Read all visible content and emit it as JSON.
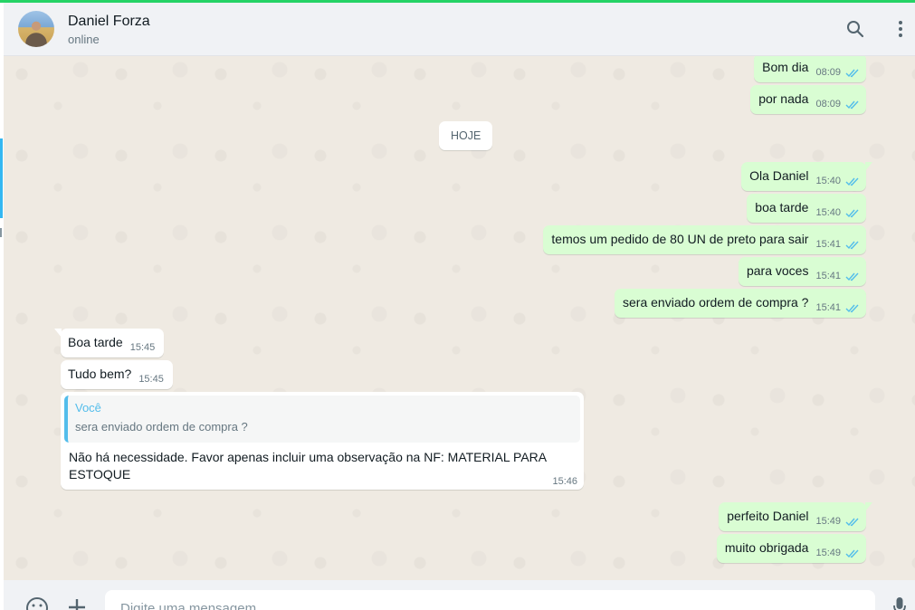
{
  "header": {
    "contact_name": "Daniel Forza",
    "contact_status": "online"
  },
  "date_chip": "HOJE",
  "messages_earlier": [
    {
      "text": "Bom dia",
      "time": "08:09",
      "direction": "out",
      "status": "read"
    },
    {
      "text": "por nada",
      "time": "08:09",
      "direction": "out",
      "status": "read"
    }
  ],
  "messages_today": [
    {
      "text": "Ola Daniel",
      "time": "15:40",
      "direction": "out",
      "status": "read"
    },
    {
      "text": "boa tarde",
      "time": "15:40",
      "direction": "out",
      "status": "read"
    },
    {
      "text": "temos um pedido de 80 UN de preto para sair",
      "time": "15:41",
      "direction": "out",
      "status": "read"
    },
    {
      "text": "para voces",
      "time": "15:41",
      "direction": "out",
      "status": "read"
    },
    {
      "text": "sera enviado ordem de compra ?",
      "time": "15:41",
      "direction": "out",
      "status": "read"
    },
    {
      "text": "Boa tarde",
      "time": "15:45",
      "direction": "in"
    },
    {
      "text": "Tudo bem?",
      "time": "15:45",
      "direction": "in"
    }
  ],
  "reply_message": {
    "quote_author": "Você",
    "quote_text": "sera enviado ordem de compra ?",
    "text": "Não há necessidade. Favor apenas incluir uma observação na NF: MATERIAL PARA ESTOQUE",
    "time": "15:46",
    "direction": "in"
  },
  "messages_late": [
    {
      "text": "perfeito Daniel",
      "time": "15:49",
      "direction": "out",
      "status": "read"
    },
    {
      "text": "muito obrigada",
      "time": "15:49",
      "direction": "out",
      "status": "read"
    }
  ],
  "footer": {
    "input_placeholder": "Digite uma mensagem"
  },
  "icons": [
    "search-icon",
    "menu-icon",
    "emoji-icon",
    "attach-icon",
    "mic-icon",
    "double-check-icon"
  ],
  "colors": {
    "accent": "#25d366",
    "outgoing_bubble": "#d9fdd3",
    "incoming_bubble": "#ffffff",
    "chat_background": "#efeae2",
    "read_tick": "#53bdeb",
    "quote_bar": "#53bdeb"
  }
}
